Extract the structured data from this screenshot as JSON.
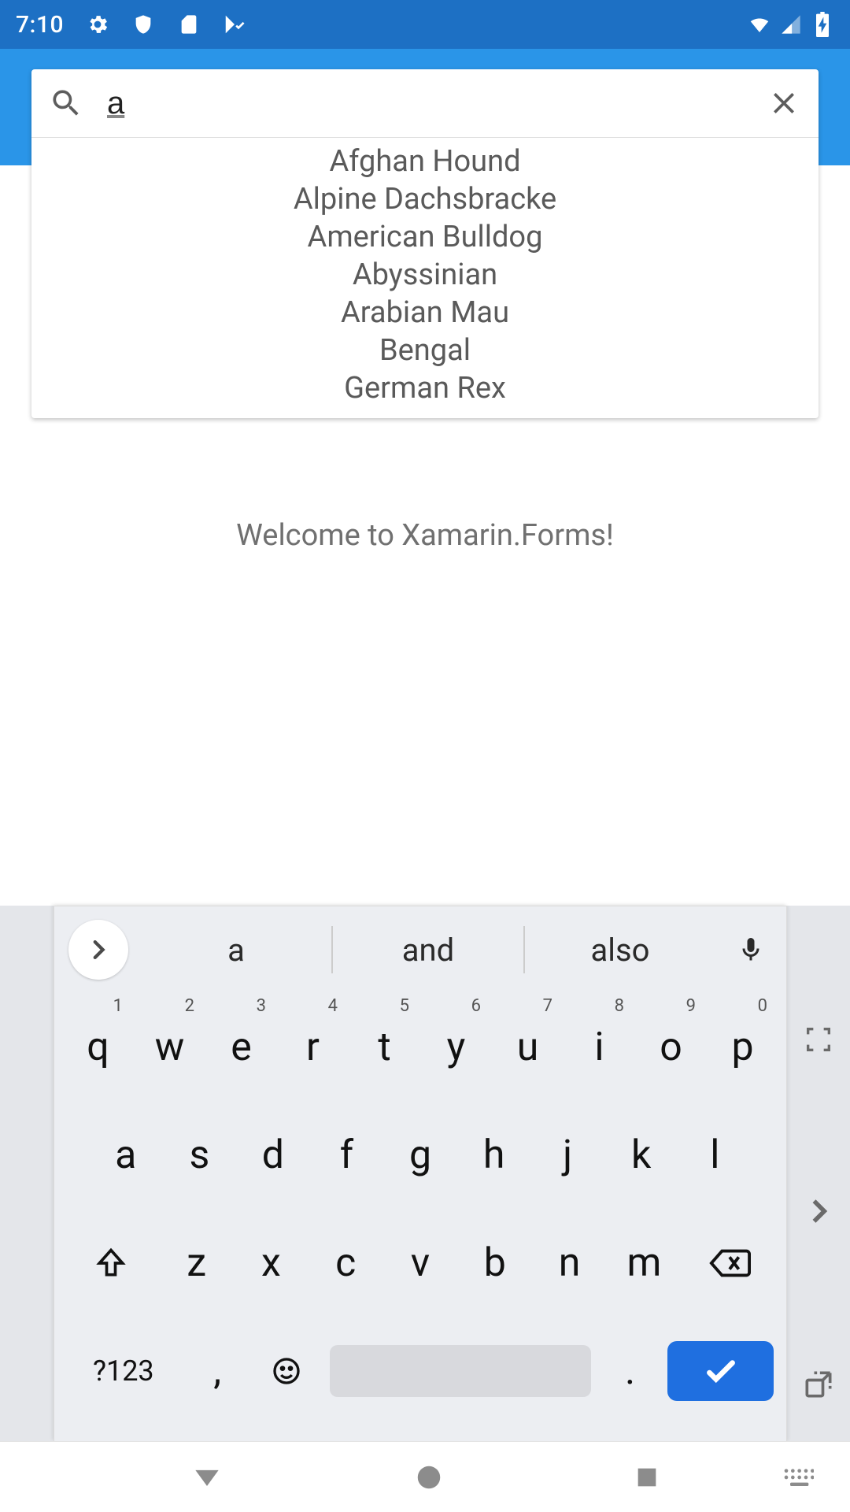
{
  "status": {
    "time": "7:10",
    "icons": {
      "gear": "gear-icon",
      "shield": "shield-icon",
      "sd": "sd-card-icon",
      "check": "play-check-icon"
    },
    "right": {
      "wifi": "wifi-icon",
      "signal": "signal-icon",
      "battery": "battery-charging-icon"
    }
  },
  "search": {
    "value": "a",
    "placeholder": "",
    "suggestions": [
      "Afghan Hound",
      "Alpine Dachsbracke",
      "American Bulldog",
      "Abyssinian",
      "Arabian Mau",
      "Bengal",
      "German Rex"
    ]
  },
  "content": {
    "welcome": "Welcome to Xamarin.Forms!"
  },
  "keyboard": {
    "suggestions": [
      "a",
      "and",
      "also"
    ],
    "row1": [
      {
        "k": "q",
        "h": "1"
      },
      {
        "k": "w",
        "h": "2"
      },
      {
        "k": "e",
        "h": "3"
      },
      {
        "k": "r",
        "h": "4"
      },
      {
        "k": "t",
        "h": "5"
      },
      {
        "k": "y",
        "h": "6"
      },
      {
        "k": "u",
        "h": "7"
      },
      {
        "k": "i",
        "h": "8"
      },
      {
        "k": "o",
        "h": "9"
      },
      {
        "k": "p",
        "h": "0"
      }
    ],
    "row2": [
      "a",
      "s",
      "d",
      "f",
      "g",
      "h",
      "j",
      "k",
      "l"
    ],
    "row3": [
      "z",
      "x",
      "c",
      "v",
      "b",
      "n",
      "m"
    ],
    "symKey": "?123",
    "comma": ",",
    "period": "."
  }
}
